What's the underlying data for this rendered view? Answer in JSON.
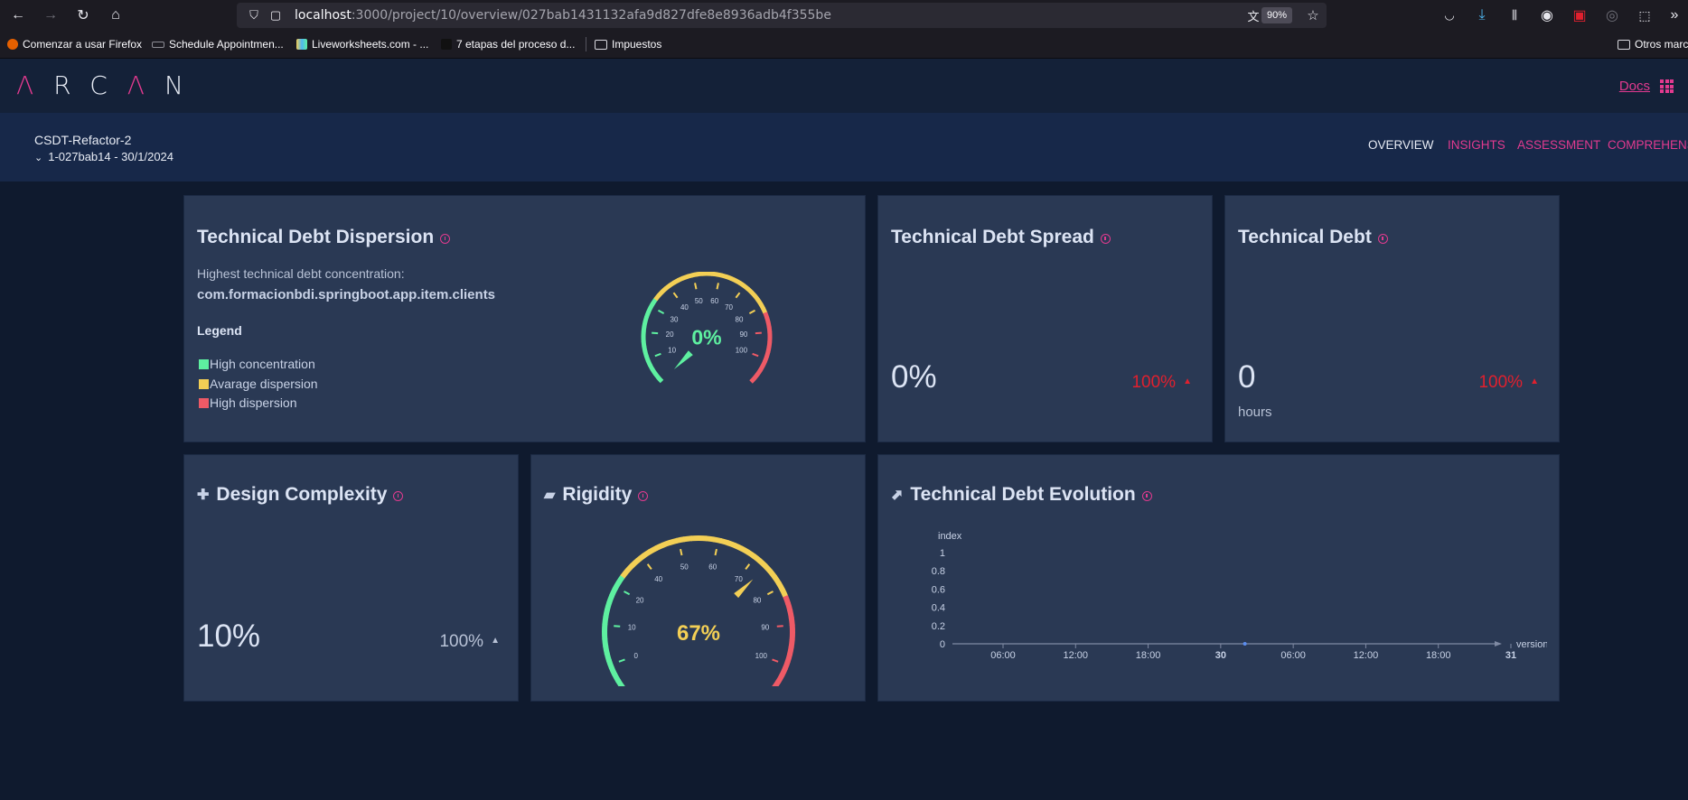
{
  "browser": {
    "url_host": "localhost",
    "url_path": ":3000/project/10/overview/027bab1431132afa9d827dfe8e8936adb4f355be",
    "zoom": "90%",
    "bookmarks": [
      {
        "label": "Comenzar a usar Firefox"
      },
      {
        "label": "Schedule Appointmen..."
      },
      {
        "label": "Liveworksheets.com - ..."
      },
      {
        "label": "7 etapas del proceso d..."
      },
      {
        "label": "Impuestos"
      },
      {
        "label": "Otros marc"
      }
    ]
  },
  "app": {
    "logo": [
      "Λ",
      "R",
      "C",
      "Λ",
      "N"
    ],
    "docs_label": "Docs",
    "project_name": "CSDT-Refactor-2",
    "project_version": "1-027bab14 - 30/1/2024",
    "nav": [
      "OVERVIEW",
      "INSIGHTS",
      "ASSESSMENT",
      "COMPREHENSI"
    ]
  },
  "colors": {
    "accent": "#e23a8f",
    "green": "#5ef0a0",
    "yellow": "#f3cf55",
    "red": "#ee5a66",
    "trend_red": "#e0202e"
  },
  "cards": {
    "dispersion": {
      "title": "Technical Debt Dispersion",
      "highest_label": "Highest technical debt concentration:",
      "highest_value": "com.formacionbdi.springboot.app.item.clients",
      "legend_title": "Legend",
      "legend": [
        {
          "label": "High concentration",
          "color": "#5ef0a0"
        },
        {
          "label": "Avarage dispersion",
          "color": "#f3cf55"
        },
        {
          "label": "High dispersion",
          "color": "#ee5a66"
        }
      ],
      "gauge_value": 0,
      "gauge_label": "0%",
      "gauge_ticks": [
        "10",
        "20",
        "30",
        "40",
        "50",
        "60",
        "70",
        "80",
        "90",
        "100"
      ]
    },
    "spread": {
      "title": "Technical Debt Spread",
      "value": "0%",
      "trend": "100%"
    },
    "debt": {
      "title": "Technical Debt",
      "value": "0",
      "unit": "hours",
      "trend": "100%"
    },
    "complexity": {
      "title": "Design Complexity",
      "value": "10%",
      "trend": "100%"
    },
    "rigidity": {
      "title": "Rigidity",
      "gauge_value": 67,
      "gauge_label": "67%",
      "gauge_ticks": [
        "0",
        "10",
        "20",
        "40",
        "50",
        "60",
        "70",
        "80",
        "90",
        "100"
      ]
    },
    "evolution": {
      "title": "Technical Debt Evolution"
    }
  },
  "chart_data": {
    "type": "line",
    "title": "Technical Debt Evolution",
    "xlabel": "version",
    "ylabel": "index",
    "yticks": [
      "0",
      "0.2",
      "0.4",
      "0.6",
      "0.8",
      "1"
    ],
    "xticks": [
      "06:00",
      "12:00",
      "18:00",
      "30",
      "06:00",
      "12:00",
      "18:00",
      "31"
    ],
    "ylim": [
      0,
      1
    ],
    "series": [
      {
        "points": [
          {
            "x": "30 02:00",
            "y": 0
          }
        ]
      }
    ]
  }
}
